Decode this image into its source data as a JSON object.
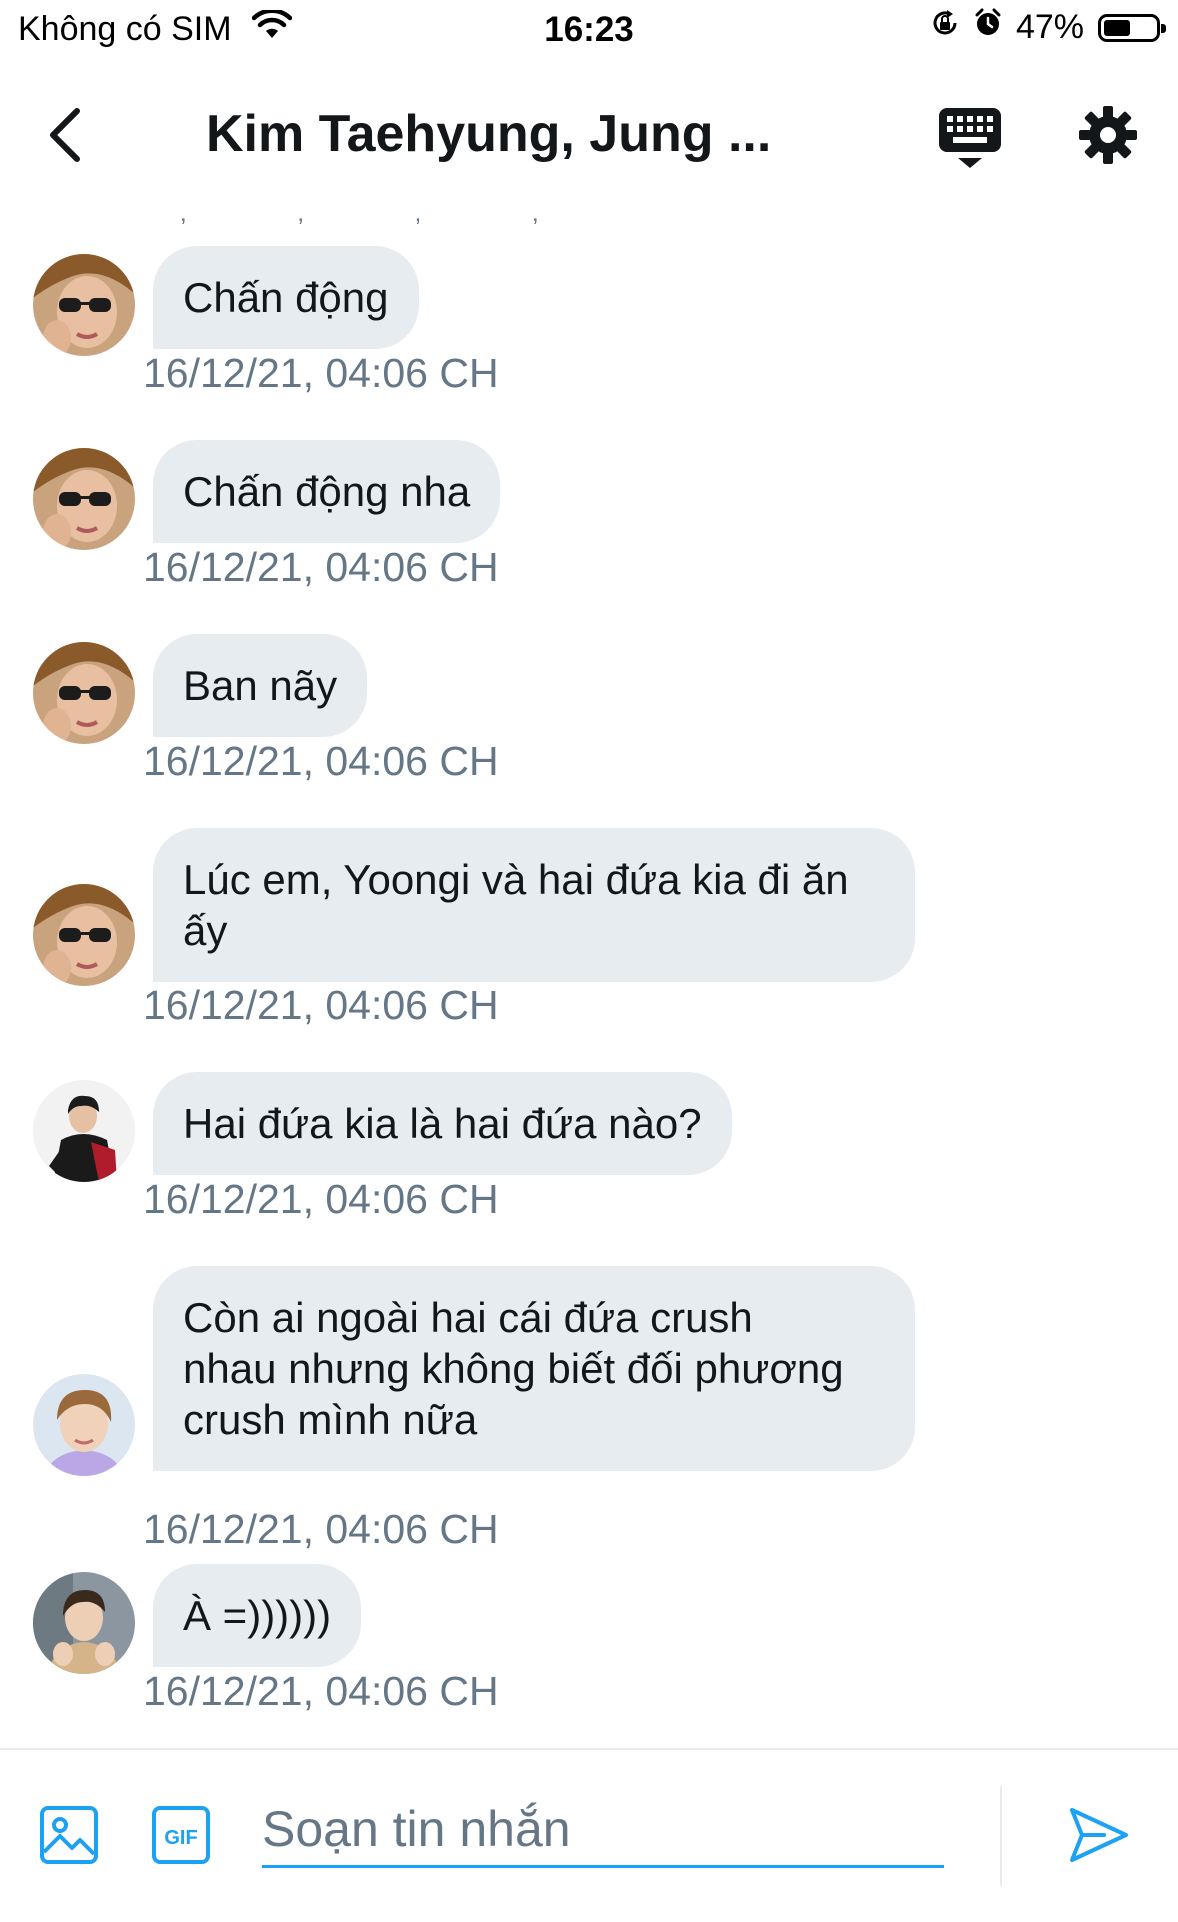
{
  "status_bar": {
    "carrier": "Không có SIM",
    "time": "16:23",
    "battery": "47%",
    "battery_level": 0.47,
    "icons": [
      "wifi-icon",
      "rotation-lock-icon",
      "alarm-icon",
      "battery-icon"
    ]
  },
  "header": {
    "title": "Kim Taehyung, Jung ...",
    "stray_marks": ", , , ,",
    "icons": [
      "back-arrow-icon",
      "keyboard-icon",
      "gear-icon"
    ]
  },
  "messages": [
    {
      "sender": "taehyung",
      "text": "Chấn động",
      "time": "16/12/21, 04:06 CH"
    },
    {
      "sender": "taehyung",
      "text": "Chấn động nha",
      "time": "16/12/21, 04:06 CH"
    },
    {
      "sender": "taehyung",
      "text": "Ban nãy",
      "time": "16/12/21, 04:06 CH"
    },
    {
      "sender": "taehyung",
      "text": "Lúc em, Yoongi và hai đứa kia đi ăn\nấy",
      "time": "16/12/21, 04:06 CH"
    },
    {
      "sender": "member2",
      "text": "Hai đứa kia là hai đứa nào?",
      "time": "16/12/21, 04:06 CH"
    },
    {
      "sender": "member3",
      "text": "Còn ai ngoài hai cái đứa crush\nnhau nhưng không biết đối phương\ncrush mình nữa",
      "time": "16/12/21, 04:06 CH"
    },
    {
      "sender": "member4",
      "text": "À =))))))",
      "time": "16/12/21, 04:06 CH"
    }
  ],
  "composer": {
    "placeholder": "Soạn tin nhắn",
    "value": "",
    "icons": [
      "image-icon",
      "gif-icon",
      "send-icon"
    ]
  },
  "colors": {
    "accent": "#1da1f2",
    "bubble": "#e6ecf0",
    "secondary_text": "#657786",
    "primary_text": "#14171a"
  }
}
